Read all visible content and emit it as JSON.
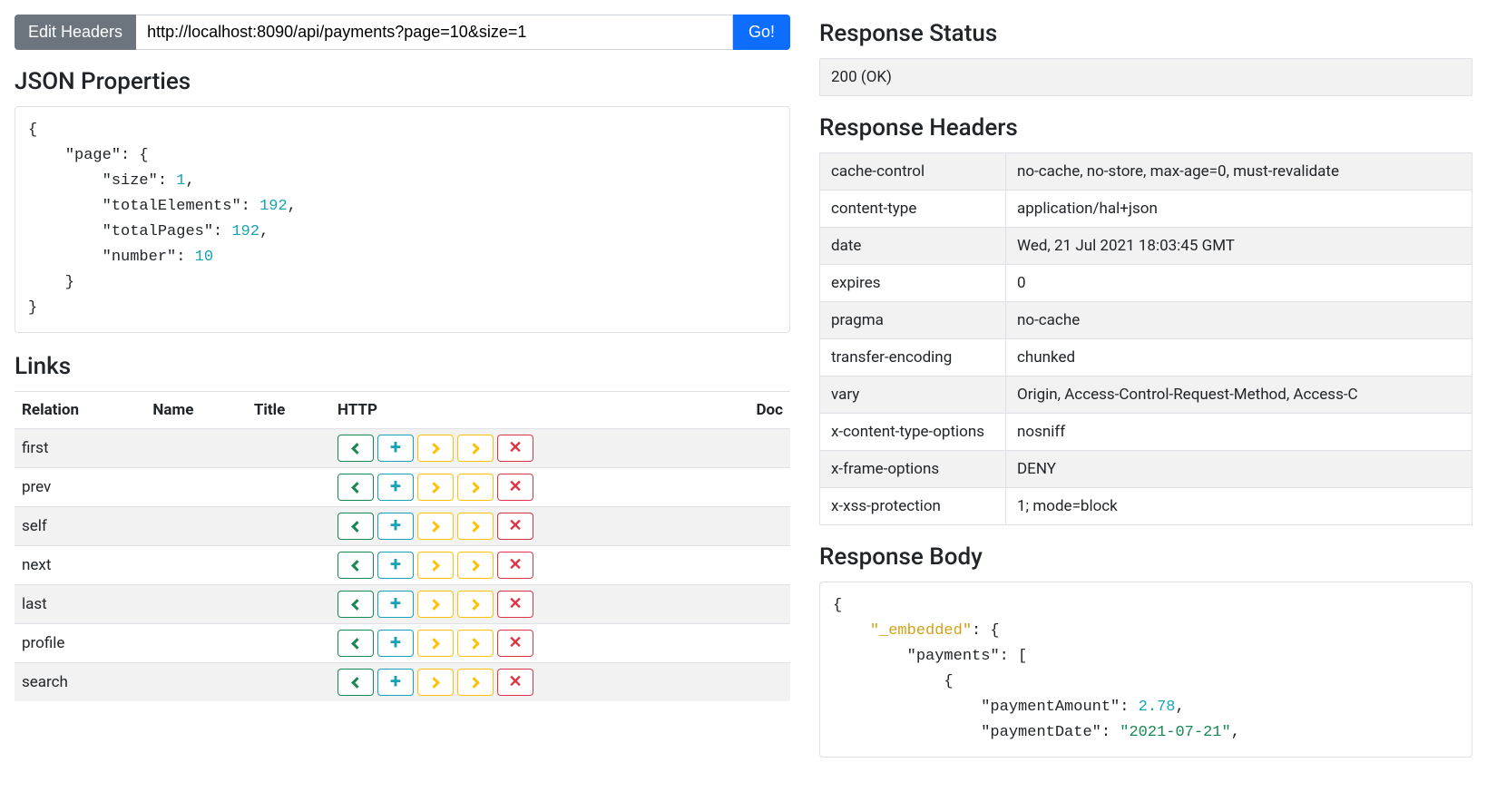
{
  "toolbar": {
    "edit_headers_label": "Edit Headers",
    "url_value": "http://localhost:8090/api/payments?page=10&size=1",
    "go_label": "Go!"
  },
  "json_props": {
    "heading": "JSON Properties",
    "page": {
      "size": 1,
      "totalElements": 192,
      "totalPages": 192,
      "number": 10
    }
  },
  "links": {
    "heading": "Links",
    "columns": [
      "Relation",
      "Name",
      "Title",
      "HTTP",
      "Doc"
    ],
    "rows": [
      {
        "relation": "first",
        "name": "",
        "title": "",
        "doc": ""
      },
      {
        "relation": "prev",
        "name": "",
        "title": "",
        "doc": ""
      },
      {
        "relation": "self",
        "name": "",
        "title": "",
        "doc": ""
      },
      {
        "relation": "next",
        "name": "",
        "title": "",
        "doc": ""
      },
      {
        "relation": "last",
        "name": "",
        "title": "",
        "doc": ""
      },
      {
        "relation": "profile",
        "name": "",
        "title": "",
        "doc": ""
      },
      {
        "relation": "search",
        "name": "",
        "title": "",
        "doc": ""
      }
    ]
  },
  "response": {
    "status_heading": "Response Status",
    "status_text": "200 (OK)",
    "headers_heading": "Response Headers",
    "headers": [
      {
        "name": "cache-control",
        "value": "no-cache, no-store, max-age=0, must-revalidate"
      },
      {
        "name": "content-type",
        "value": "application/hal+json"
      },
      {
        "name": "date",
        "value": "Wed, 21 Jul 2021 18:03:45 GMT"
      },
      {
        "name": "expires",
        "value": "0"
      },
      {
        "name": "pragma",
        "value": "no-cache"
      },
      {
        "name": "transfer-encoding",
        "value": "chunked"
      },
      {
        "name": "vary",
        "value": "Origin, Access-Control-Request-Method, Access-C"
      },
      {
        "name": "x-content-type-options",
        "value": "nosniff"
      },
      {
        "name": "x-frame-options",
        "value": "DENY"
      },
      {
        "name": "x-xss-protection",
        "value": "1; mode=block"
      }
    ],
    "body_heading": "Response Body",
    "body": {
      "_embedded": {
        "payments": [
          {
            "paymentAmount": 2.78,
            "paymentDate": "2021-07-21"
          }
        ]
      }
    }
  }
}
